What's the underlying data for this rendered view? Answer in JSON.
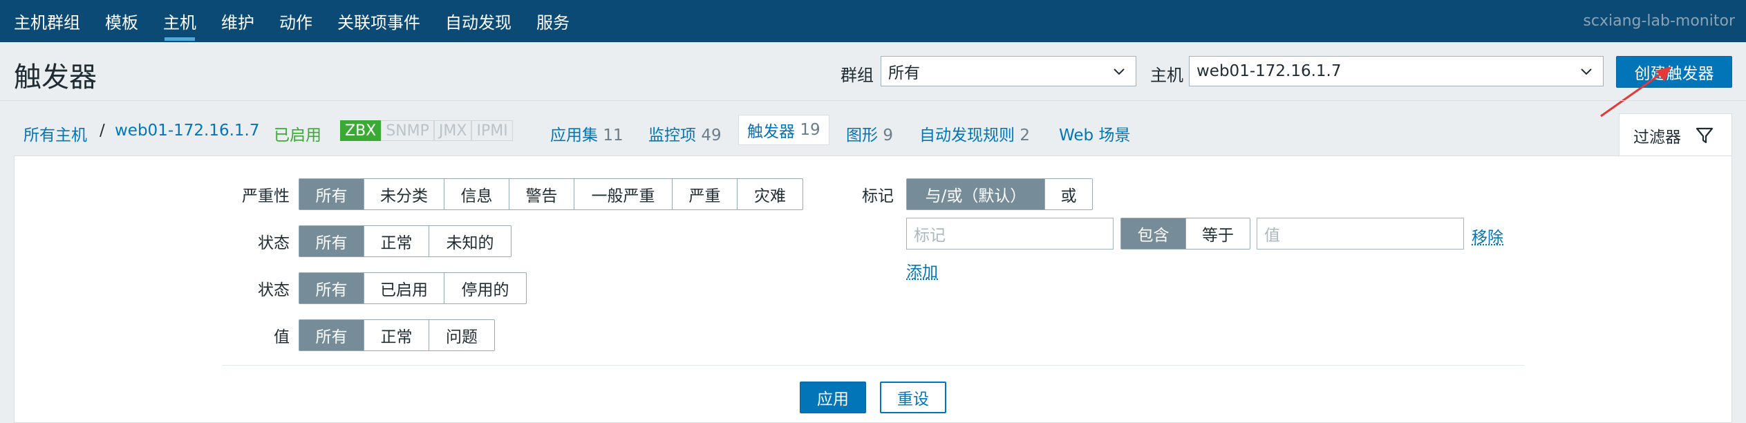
{
  "topnav": {
    "items": [
      "主机群组",
      "模板",
      "主机",
      "维护",
      "动作",
      "关联项事件",
      "自动发现",
      "服务"
    ],
    "active_index": 2,
    "server_name": "scxiang-lab-monitor"
  },
  "header": {
    "title": "触发器",
    "group_label": "群组",
    "group_value": "所有",
    "host_label": "主机",
    "host_value": "web01-172.16.1.7",
    "create_button": "创建触发器"
  },
  "hostnav": {
    "all_hosts": "所有主机",
    "separator": "/",
    "host": "web01-172.16.1.7",
    "status": "已启用",
    "badges": [
      "ZBX",
      "SNMP",
      "JMX",
      "IPMI"
    ],
    "links": {
      "applications": {
        "label": "应用集",
        "count": "11"
      },
      "items": {
        "label": "监控项",
        "count": "49"
      },
      "triggers": {
        "label": "触发器",
        "count": "19"
      },
      "graphs": {
        "label": "图形",
        "count": "9"
      },
      "discovery": {
        "label": "自动发现规则",
        "count": "2"
      },
      "web": {
        "label": "Web 场景"
      }
    },
    "filter_tab": "过滤器"
  },
  "filter": {
    "severity": {
      "label": "严重性",
      "options": [
        "所有",
        "未分类",
        "信息",
        "警告",
        "一般严重",
        "严重",
        "灾难"
      ]
    },
    "state": {
      "label": "状态",
      "options": [
        "所有",
        "正常",
        "未知的"
      ]
    },
    "status": {
      "label": "状态",
      "options": [
        "所有",
        "已启用",
        "停用的"
      ]
    },
    "value": {
      "label": "值",
      "options": [
        "所有",
        "正常",
        "问题"
      ]
    },
    "tags": {
      "label": "标记",
      "mode_options": [
        "与/或（默认）",
        "或"
      ],
      "tag_placeholder": "标记",
      "operator_options": [
        "包含",
        "等于"
      ],
      "value_placeholder": "值",
      "remove": "移除",
      "add": "添加"
    },
    "apply": "应用",
    "reset": "重设"
  },
  "colors": {
    "nav_bg": "#0b4a74",
    "primary": "#0275b8",
    "enabled_green": "#3aaa35",
    "selected_segment": "#768d99",
    "annotation_red": "#e53935"
  }
}
